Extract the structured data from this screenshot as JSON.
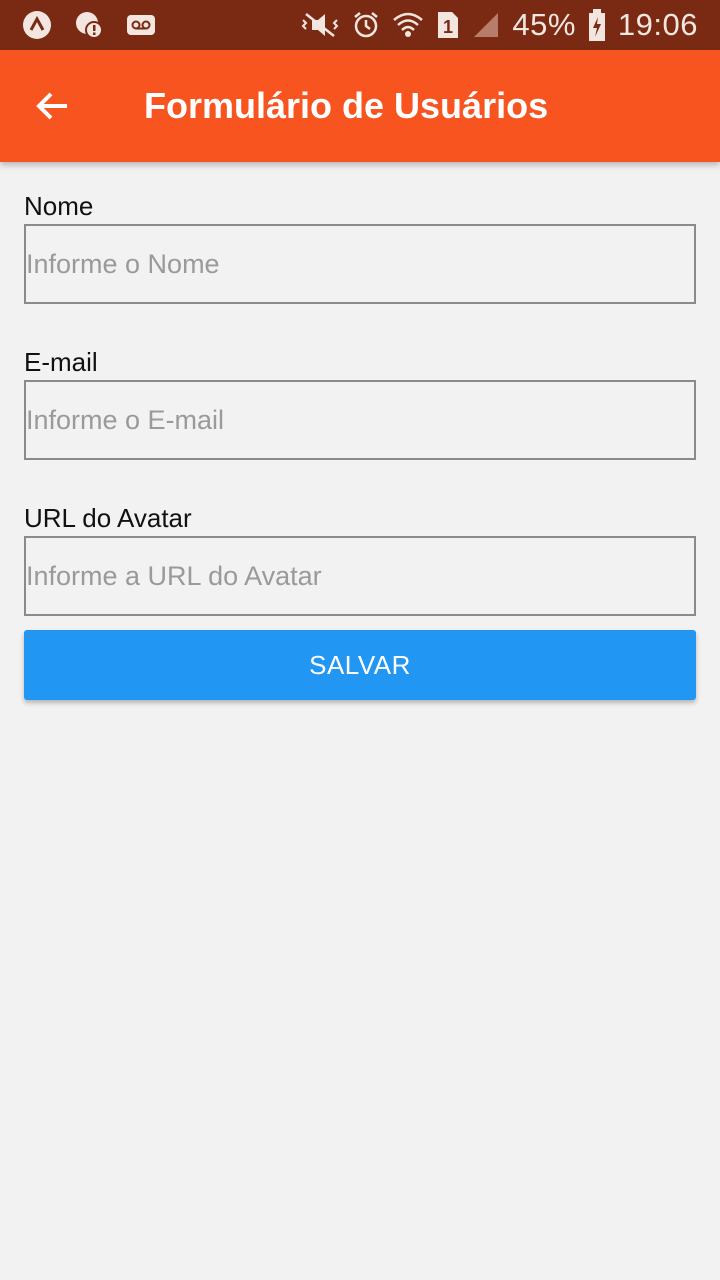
{
  "status_bar": {
    "battery": "45%",
    "time": "19:06",
    "sim_slot": "1",
    "icons": [
      "app-launcher-icon",
      "notification-alert-icon",
      "voicemail-icon",
      "mute-vibrate-icon",
      "alarm-icon",
      "wifi-icon",
      "sim-icon",
      "cell-signal-icon",
      "battery-charging-icon"
    ]
  },
  "app_bar": {
    "title": "Formulário de Usuários",
    "back_icon": "arrow-back-icon",
    "background": "#f75420"
  },
  "form": {
    "fields": [
      {
        "label": "Nome",
        "placeholder": "Informe o Nome",
        "value": ""
      },
      {
        "label": "E-mail",
        "placeholder": "Informe o E-mail",
        "value": ""
      },
      {
        "label": "URL do Avatar",
        "placeholder": "Informe a URL do Avatar",
        "value": ""
      }
    ],
    "save_label": "SALVAR",
    "save_color": "#2196f3"
  }
}
